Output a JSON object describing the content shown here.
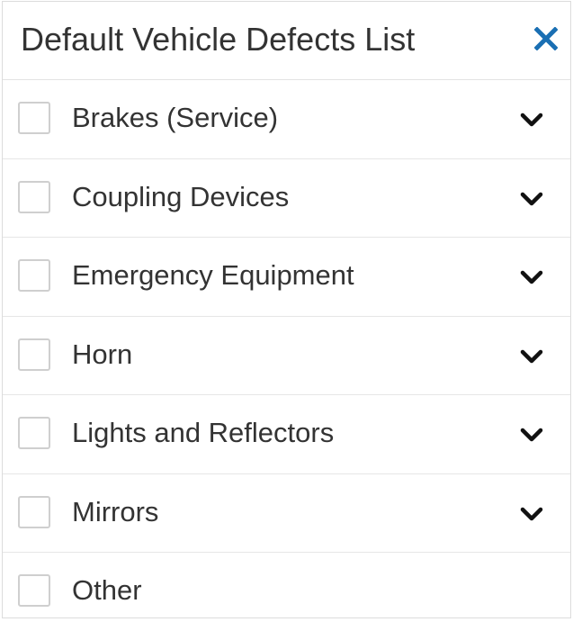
{
  "header": {
    "title": "Default Vehicle Defects List",
    "close_icon": "close-icon",
    "accent_color": "#1a6fb3"
  },
  "defects": [
    {
      "label": "Brakes (Service)",
      "checked": false,
      "expandable": true
    },
    {
      "label": "Coupling Devices",
      "checked": false,
      "expandable": true
    },
    {
      "label": "Emergency Equipment",
      "checked": false,
      "expandable": true
    },
    {
      "label": "Horn",
      "checked": false,
      "expandable": true
    },
    {
      "label": "Lights and Reflectors",
      "checked": false,
      "expandable": true
    },
    {
      "label": "Mirrors",
      "checked": false,
      "expandable": true
    },
    {
      "label": "Other",
      "checked": false,
      "expandable": false
    }
  ]
}
